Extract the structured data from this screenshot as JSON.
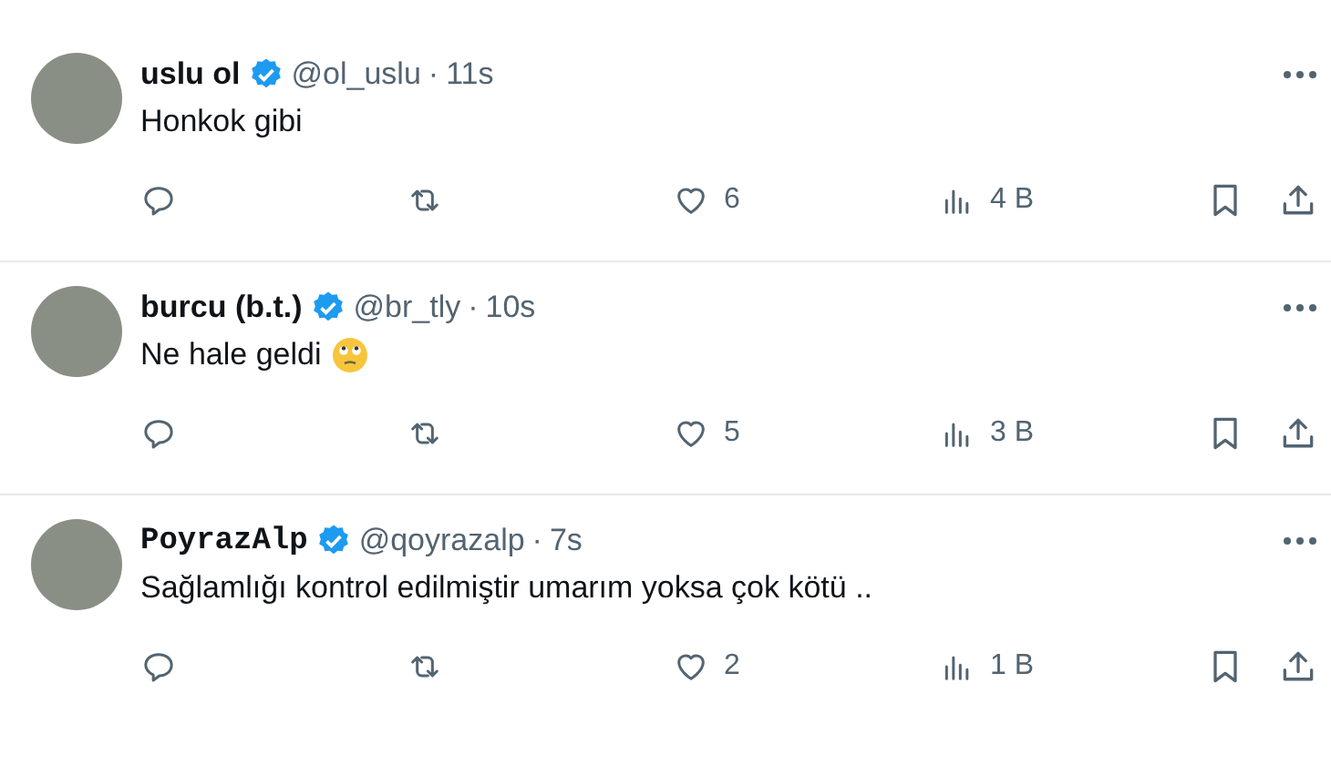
{
  "posts": [
    {
      "name": "uslu ol",
      "kind": "plain",
      "verified": true,
      "handle": "@ol_uslu",
      "separator": "·",
      "time": "11s",
      "text": "Honkok gibi",
      "emoji": false,
      "likes": "6",
      "views": "4 B"
    },
    {
      "name": "burcu (b.t.)",
      "kind": "plain",
      "verified": true,
      "handle": "@br_tly",
      "separator": "·",
      "time": "10s",
      "text": "Ne hale geldi",
      "emoji": true,
      "likes": "5",
      "views": "3 B"
    },
    {
      "name": "PoyrazAlp",
      "kind": "fancy",
      "verified": true,
      "handle": "@qoyrazalp",
      "separator": "·",
      "time": "7s",
      "text": "Sağlamlığı kontrol edilmiştir umarım yoksa çok kötü ..",
      "emoji": false,
      "likes": "2",
      "views": "1 B"
    }
  ]
}
